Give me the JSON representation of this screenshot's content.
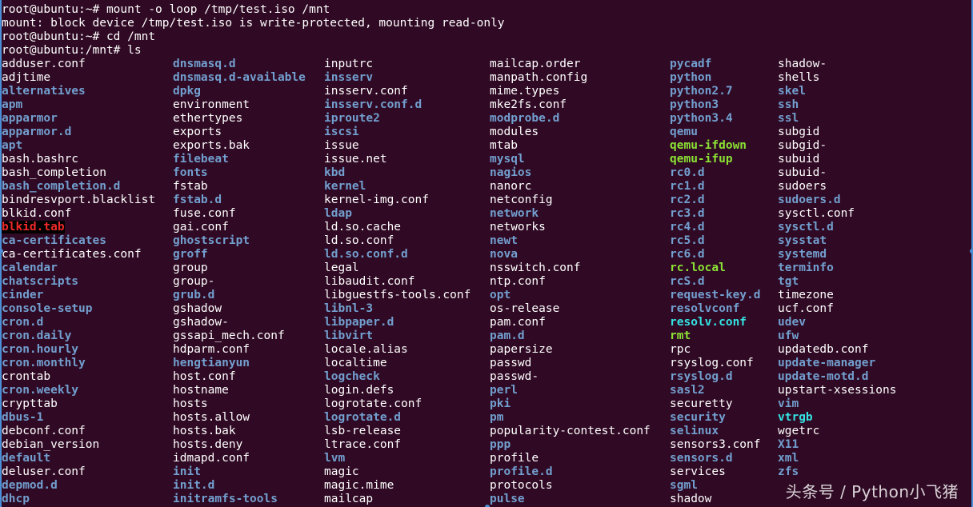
{
  "terminal": {
    "background": "#300a24",
    "colors": {
      "file": "#ffffff",
      "dir": "#729fcf",
      "exec": "#8ae234",
      "link": "#34e2e2",
      "orphan": "#ef2929"
    },
    "lines": [
      "root@ubuntu:~# mount -o loop /tmp/test.iso /mnt",
      "mount: block device /tmp/test.iso is write-protected, mounting read-only",
      "root@ubuntu:~# cd /mnt",
      "root@ubuntu:/mnt# ls"
    ],
    "columns": [
      [
        {
          "name": "adduser.conf",
          "type": "file"
        },
        {
          "name": "adjtime",
          "type": "file"
        },
        {
          "name": "alternatives",
          "type": "dir"
        },
        {
          "name": "apm",
          "type": "dir"
        },
        {
          "name": "apparmor",
          "type": "dir"
        },
        {
          "name": "apparmor.d",
          "type": "dir"
        },
        {
          "name": "apt",
          "type": "dir"
        },
        {
          "name": "bash.bashrc",
          "type": "file"
        },
        {
          "name": "bash_completion",
          "type": "file"
        },
        {
          "name": "bash_completion.d",
          "type": "dir"
        },
        {
          "name": "bindresvport.blacklist",
          "type": "file"
        },
        {
          "name": "blkid.conf",
          "type": "file"
        },
        {
          "name": "blkid.tab",
          "type": "orphan"
        },
        {
          "name": "ca-certificates",
          "type": "dir"
        },
        {
          "name": "ca-certificates.conf",
          "type": "file"
        },
        {
          "name": "calendar",
          "type": "dir"
        },
        {
          "name": "chatscripts",
          "type": "dir"
        },
        {
          "name": "cinder",
          "type": "dir"
        },
        {
          "name": "console-setup",
          "type": "dir"
        },
        {
          "name": "cron.d",
          "type": "dir"
        },
        {
          "name": "cron.daily",
          "type": "dir"
        },
        {
          "name": "cron.hourly",
          "type": "dir"
        },
        {
          "name": "cron.monthly",
          "type": "dir"
        },
        {
          "name": "crontab",
          "type": "file"
        },
        {
          "name": "cron.weekly",
          "type": "dir"
        },
        {
          "name": "crypttab",
          "type": "file"
        },
        {
          "name": "dbus-1",
          "type": "dir"
        },
        {
          "name": "debconf.conf",
          "type": "file"
        },
        {
          "name": "debian_version",
          "type": "file"
        },
        {
          "name": "default",
          "type": "dir"
        },
        {
          "name": "deluser.conf",
          "type": "file"
        },
        {
          "name": "depmod.d",
          "type": "dir"
        },
        {
          "name": "dhcp",
          "type": "dir"
        }
      ],
      [
        {
          "name": "dnsmasq.d",
          "type": "dir"
        },
        {
          "name": "dnsmasq.d-available",
          "type": "dir"
        },
        {
          "name": "dpkg",
          "type": "dir"
        },
        {
          "name": "environment",
          "type": "file"
        },
        {
          "name": "ethertypes",
          "type": "file"
        },
        {
          "name": "exports",
          "type": "file"
        },
        {
          "name": "exports.bak",
          "type": "file"
        },
        {
          "name": "filebeat",
          "type": "dir"
        },
        {
          "name": "fonts",
          "type": "dir"
        },
        {
          "name": "fstab",
          "type": "file"
        },
        {
          "name": "fstab.d",
          "type": "dir"
        },
        {
          "name": "fuse.conf",
          "type": "file"
        },
        {
          "name": "gai.conf",
          "type": "file"
        },
        {
          "name": "ghostscript",
          "type": "dir"
        },
        {
          "name": "groff",
          "type": "dir"
        },
        {
          "name": "group",
          "type": "file"
        },
        {
          "name": "group-",
          "type": "file"
        },
        {
          "name": "grub.d",
          "type": "dir"
        },
        {
          "name": "gshadow",
          "type": "file"
        },
        {
          "name": "gshadow-",
          "type": "file"
        },
        {
          "name": "gssapi_mech.conf",
          "type": "file"
        },
        {
          "name": "hdparm.conf",
          "type": "file"
        },
        {
          "name": "hengtianyun",
          "type": "dir"
        },
        {
          "name": "host.conf",
          "type": "file"
        },
        {
          "name": "hostname",
          "type": "file"
        },
        {
          "name": "hosts",
          "type": "file"
        },
        {
          "name": "hosts.allow",
          "type": "file"
        },
        {
          "name": "hosts.bak",
          "type": "file"
        },
        {
          "name": "hosts.deny",
          "type": "file"
        },
        {
          "name": "idmapd.conf",
          "type": "file"
        },
        {
          "name": "init",
          "type": "dir"
        },
        {
          "name": "init.d",
          "type": "dir"
        },
        {
          "name": "initramfs-tools",
          "type": "dir"
        }
      ],
      [
        {
          "name": "inputrc",
          "type": "file"
        },
        {
          "name": "insserv",
          "type": "dir"
        },
        {
          "name": "insserv.conf",
          "type": "file"
        },
        {
          "name": "insserv.conf.d",
          "type": "dir"
        },
        {
          "name": "iproute2",
          "type": "dir"
        },
        {
          "name": "iscsi",
          "type": "dir"
        },
        {
          "name": "issue",
          "type": "file"
        },
        {
          "name": "issue.net",
          "type": "file"
        },
        {
          "name": "kbd",
          "type": "dir"
        },
        {
          "name": "kernel",
          "type": "dir"
        },
        {
          "name": "kernel-img.conf",
          "type": "file"
        },
        {
          "name": "ldap",
          "type": "dir"
        },
        {
          "name": "ld.so.cache",
          "type": "file"
        },
        {
          "name": "ld.so.conf",
          "type": "file"
        },
        {
          "name": "ld.so.conf.d",
          "type": "dir"
        },
        {
          "name": "legal",
          "type": "file"
        },
        {
          "name": "libaudit.conf",
          "type": "file"
        },
        {
          "name": "libguestfs-tools.conf",
          "type": "file"
        },
        {
          "name": "libnl-3",
          "type": "dir"
        },
        {
          "name": "libpaper.d",
          "type": "dir"
        },
        {
          "name": "libvirt",
          "type": "dir"
        },
        {
          "name": "locale.alias",
          "type": "file"
        },
        {
          "name": "localtime",
          "type": "file"
        },
        {
          "name": "logcheck",
          "type": "dir"
        },
        {
          "name": "login.defs",
          "type": "file"
        },
        {
          "name": "logrotate.conf",
          "type": "file"
        },
        {
          "name": "logrotate.d",
          "type": "dir"
        },
        {
          "name": "lsb-release",
          "type": "file"
        },
        {
          "name": "ltrace.conf",
          "type": "file"
        },
        {
          "name": "lvm",
          "type": "dir"
        },
        {
          "name": "magic",
          "type": "file"
        },
        {
          "name": "magic.mime",
          "type": "file"
        },
        {
          "name": "mailcap",
          "type": "file"
        }
      ],
      [
        {
          "name": "mailcap.order",
          "type": "file"
        },
        {
          "name": "manpath.config",
          "type": "file"
        },
        {
          "name": "mime.types",
          "type": "file"
        },
        {
          "name": "mke2fs.conf",
          "type": "file"
        },
        {
          "name": "modprobe.d",
          "type": "dir"
        },
        {
          "name": "modules",
          "type": "file"
        },
        {
          "name": "mtab",
          "type": "file"
        },
        {
          "name": "mysql",
          "type": "dir"
        },
        {
          "name": "nagios",
          "type": "dir"
        },
        {
          "name": "nanorc",
          "type": "file"
        },
        {
          "name": "netconfig",
          "type": "file"
        },
        {
          "name": "network",
          "type": "dir"
        },
        {
          "name": "networks",
          "type": "file"
        },
        {
          "name": "newt",
          "type": "dir"
        },
        {
          "name": "nova",
          "type": "dir"
        },
        {
          "name": "nsswitch.conf",
          "type": "file"
        },
        {
          "name": "ntp.conf",
          "type": "file"
        },
        {
          "name": "opt",
          "type": "dir"
        },
        {
          "name": "os-release",
          "type": "file"
        },
        {
          "name": "pam.conf",
          "type": "file"
        },
        {
          "name": "pam.d",
          "type": "dir"
        },
        {
          "name": "papersize",
          "type": "file"
        },
        {
          "name": "passwd",
          "type": "file"
        },
        {
          "name": "passwd-",
          "type": "file"
        },
        {
          "name": "perl",
          "type": "dir"
        },
        {
          "name": "pki",
          "type": "dir"
        },
        {
          "name": "pm",
          "type": "dir"
        },
        {
          "name": "popularity-contest.conf",
          "type": "file"
        },
        {
          "name": "ppp",
          "type": "dir"
        },
        {
          "name": "profile",
          "type": "file"
        },
        {
          "name": "profile.d",
          "type": "dir"
        },
        {
          "name": "protocols",
          "type": "file"
        },
        {
          "name": "pulse",
          "type": "dir"
        }
      ],
      [
        {
          "name": "pycadf",
          "type": "dir"
        },
        {
          "name": "python",
          "type": "dir"
        },
        {
          "name": "python2.7",
          "type": "dir"
        },
        {
          "name": "python3",
          "type": "dir"
        },
        {
          "name": "python3.4",
          "type": "dir"
        },
        {
          "name": "qemu",
          "type": "dir"
        },
        {
          "name": "qemu-ifdown",
          "type": "exec"
        },
        {
          "name": "qemu-ifup",
          "type": "exec"
        },
        {
          "name": "rc0.d",
          "type": "dir"
        },
        {
          "name": "rc1.d",
          "type": "dir"
        },
        {
          "name": "rc2.d",
          "type": "dir"
        },
        {
          "name": "rc3.d",
          "type": "dir"
        },
        {
          "name": "rc4.d",
          "type": "dir"
        },
        {
          "name": "rc5.d",
          "type": "dir"
        },
        {
          "name": "rc6.d",
          "type": "dir"
        },
        {
          "name": "rc.local",
          "type": "exec"
        },
        {
          "name": "rcS.d",
          "type": "dir"
        },
        {
          "name": "request-key.d",
          "type": "dir"
        },
        {
          "name": "resolvconf",
          "type": "dir"
        },
        {
          "name": "resolv.conf",
          "type": "link"
        },
        {
          "name": "rmt",
          "type": "exec"
        },
        {
          "name": "rpc",
          "type": "file"
        },
        {
          "name": "rsyslog.conf",
          "type": "file"
        },
        {
          "name": "rsyslog.d",
          "type": "dir"
        },
        {
          "name": "sasl2",
          "type": "dir"
        },
        {
          "name": "securetty",
          "type": "file"
        },
        {
          "name": "security",
          "type": "dir"
        },
        {
          "name": "selinux",
          "type": "dir"
        },
        {
          "name": "sensors3.conf",
          "type": "file"
        },
        {
          "name": "sensors.d",
          "type": "dir"
        },
        {
          "name": "services",
          "type": "file"
        },
        {
          "name": "sgml",
          "type": "dir"
        },
        {
          "name": "shadow",
          "type": "file"
        }
      ],
      [
        {
          "name": "shadow-",
          "type": "file"
        },
        {
          "name": "shells",
          "type": "file"
        },
        {
          "name": "skel",
          "type": "dir"
        },
        {
          "name": "ssh",
          "type": "dir"
        },
        {
          "name": "ssl",
          "type": "dir"
        },
        {
          "name": "subgid",
          "type": "file"
        },
        {
          "name": "subgid-",
          "type": "file"
        },
        {
          "name": "subuid",
          "type": "file"
        },
        {
          "name": "subuid-",
          "type": "file"
        },
        {
          "name": "sudoers",
          "type": "file"
        },
        {
          "name": "sudoers.d",
          "type": "dir"
        },
        {
          "name": "sysctl.conf",
          "type": "file"
        },
        {
          "name": "sysctl.d",
          "type": "dir"
        },
        {
          "name": "sysstat",
          "type": "dir"
        },
        {
          "name": "systemd",
          "type": "dir"
        },
        {
          "name": "terminfo",
          "type": "dir"
        },
        {
          "name": "tgt",
          "type": "dir"
        },
        {
          "name": "timezone",
          "type": "file"
        },
        {
          "name": "ucf.conf",
          "type": "file"
        },
        {
          "name": "udev",
          "type": "dir"
        },
        {
          "name": "ufw",
          "type": "dir"
        },
        {
          "name": "updatedb.conf",
          "type": "file"
        },
        {
          "name": "update-manager",
          "type": "dir"
        },
        {
          "name": "update-motd.d",
          "type": "dir"
        },
        {
          "name": "upstart-xsessions",
          "type": "file"
        },
        {
          "name": "vim",
          "type": "dir"
        },
        {
          "name": "vtrgb",
          "type": "link"
        },
        {
          "name": "wgetrc",
          "type": "file"
        },
        {
          "name": "X11",
          "type": "dir"
        },
        {
          "name": "xml",
          "type": "dir"
        },
        {
          "name": "zfs",
          "type": "dir"
        }
      ]
    ]
  },
  "watermark": "头条号 / Python小飞猪"
}
